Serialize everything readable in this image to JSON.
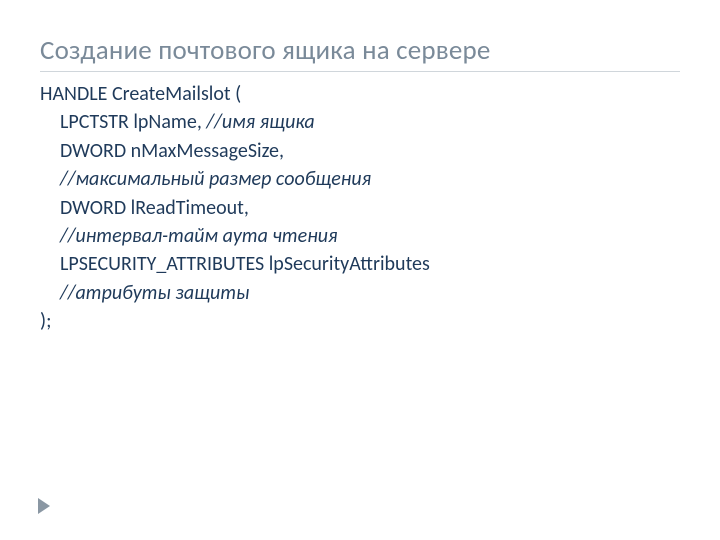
{
  "title": "Создание почтового ящика на сервере",
  "body": {
    "l1": "HANDLE CreateMailslot (",
    "l2_code": "LPCTSTR lpName, ",
    "l2_comment": "//имя ящика",
    "l3_code": "DWORD nMaxMessageSize,",
    "l3_comment": "//максимальный размер сообщения",
    "l4_code": "DWORD lReadTimeout,",
    "l4_comment": "//интервал-тайм аута чтения",
    "l5_code": "LPSECURITY_ATTRIBUTES  lpSecurityAttributes",
    "l5_comment": "//атрибуты защиты",
    "l6": ");"
  }
}
